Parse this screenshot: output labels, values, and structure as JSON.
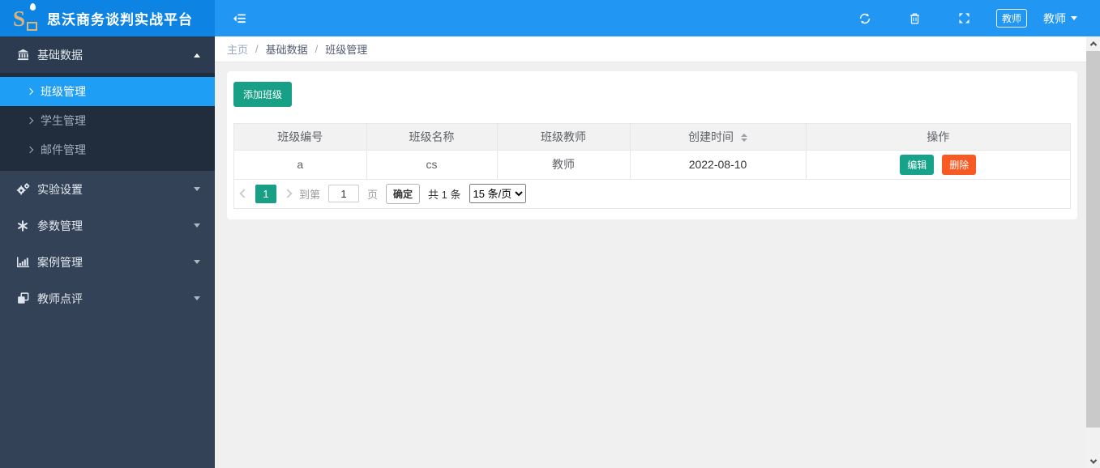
{
  "colors": {
    "header_blue": "#2196f3",
    "header_logo_blue": "#0d84e3",
    "sidebar_bg": "#344257",
    "submenu_bg": "#212d3d",
    "active_item_blue": "#1e9ef4",
    "accent_teal": "#17a085",
    "danger_orange": "#f95a23",
    "logo_gold": "#d6b779"
  },
  "header": {
    "logo_letter": "S",
    "app_title": "思沃商务谈判实战平台",
    "teacher_badge": "教师",
    "user_menu_label": "教师"
  },
  "sidebar": {
    "items": [
      {
        "label": "基础数据",
        "icon": "bank-icon",
        "expanded": true,
        "children": [
          {
            "label": "班级管理",
            "active": true
          },
          {
            "label": "学生管理",
            "active": false
          },
          {
            "label": "邮件管理",
            "active": false
          }
        ]
      },
      {
        "label": "实验设置",
        "icon": "cogs-icon",
        "expanded": false
      },
      {
        "label": "参数管理",
        "icon": "asterisk-icon",
        "expanded": false
      },
      {
        "label": "案例管理",
        "icon": "bar-chart-icon",
        "expanded": false
      },
      {
        "label": "教师点评",
        "icon": "clone-icon",
        "expanded": false
      }
    ]
  },
  "breadcrumb": {
    "items": [
      "主页",
      "基础数据",
      "班级管理"
    ],
    "separator": "/"
  },
  "main": {
    "add_button_label": "添加班级",
    "table": {
      "columns": [
        "班级编号",
        "班级名称",
        "班级教师",
        "创建时间",
        "操作"
      ],
      "sortable_column": "创建时间",
      "rows": [
        {
          "class_id": "a",
          "class_name": "cs",
          "teacher": "教师",
          "created_at": "2022-08-10",
          "edit_label": "编辑",
          "delete_label": "删除"
        }
      ]
    },
    "pagination": {
      "current_page": "1",
      "goto_prefix": "到第",
      "page_input_value": "1",
      "goto_suffix": "页",
      "confirm_label": "确定",
      "total_text": "共 1 条",
      "page_size_option": "15 条/页"
    }
  }
}
